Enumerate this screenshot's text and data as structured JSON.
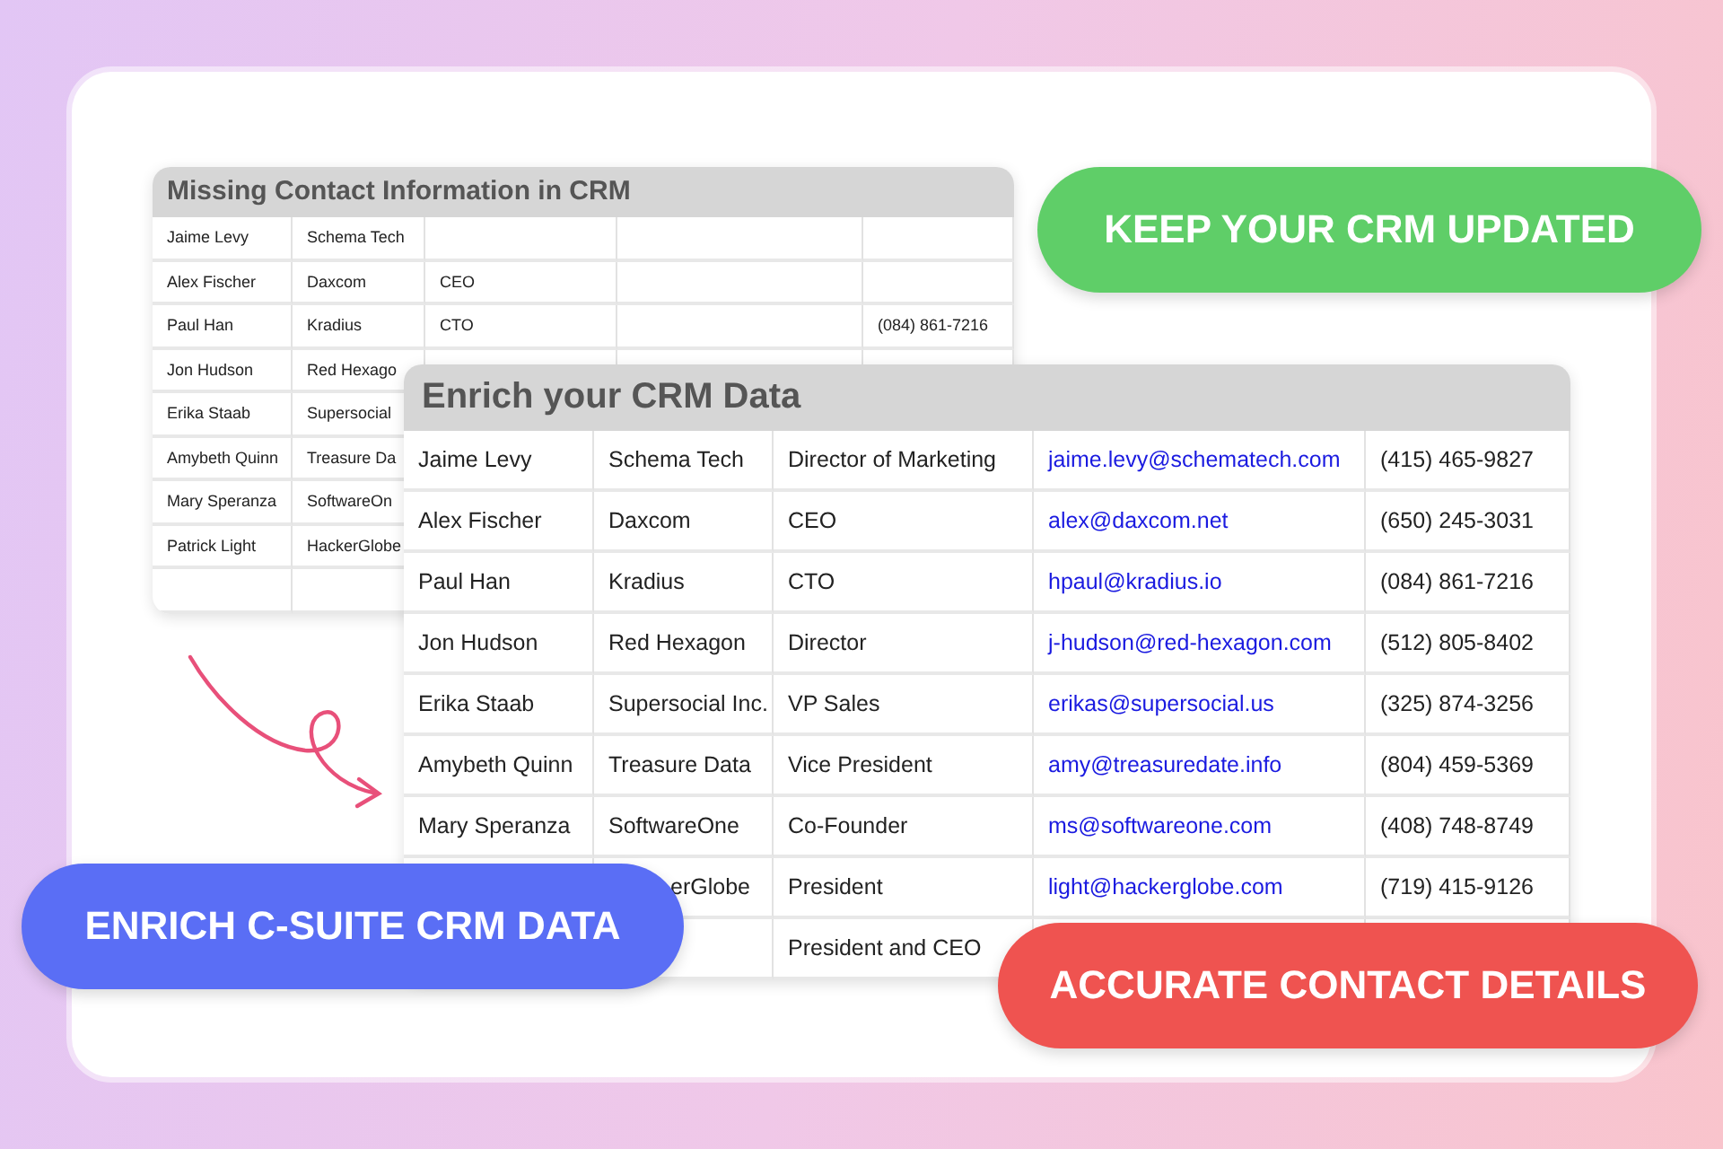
{
  "missing_table": {
    "title": "Missing Contact Information in CRM",
    "rows": [
      [
        "Jaime Levy",
        "Schema Tech",
        null,
        null,
        null
      ],
      [
        "Alex Fischer",
        "Daxcom",
        "CEO",
        null,
        null
      ],
      [
        "Paul Han",
        "Kradius",
        "CTO",
        null,
        "(084) 861-7216"
      ],
      [
        "Jon Hudson",
        "Red Hexago",
        null,
        null,
        null
      ],
      [
        "Erika Staab",
        "Supersocial",
        null,
        null,
        null
      ],
      [
        "Amybeth Quinn",
        "Treasure Da",
        null,
        null,
        null
      ],
      [
        "Mary Speranza",
        "SoftwareOn",
        null,
        null,
        null
      ],
      [
        "Patrick Light",
        "HackerGlobe",
        null,
        null,
        null
      ],
      [
        null,
        null,
        null,
        null,
        null
      ]
    ]
  },
  "enriched_table": {
    "title": "Enrich your CRM Data",
    "rows": [
      [
        "Jaime Levy",
        "Schema Tech",
        "Director of Marketing",
        "jaime.levy@schematech.com",
        "(415) 465-9827"
      ],
      [
        "Alex Fischer",
        "Daxcom",
        "CEO",
        "alex@daxcom.net",
        "(650) 245-3031"
      ],
      [
        "Paul Han",
        "Kradius",
        "CTO",
        "hpaul@kradius.io",
        "(084) 861-7216"
      ],
      [
        "Jon Hudson",
        "Red Hexagon",
        "Director",
        "j-hudson@red-hexagon.com",
        "(512) 805-8402"
      ],
      [
        "Erika Staab",
        "Supersocial Inc.",
        "VP Sales",
        "erikas@supersocial.us",
        "(325) 874-3256"
      ],
      [
        "Amybeth Quinn",
        "Treasure Data",
        "Vice President",
        "amy@treasuredate.info",
        "(804) 459-5369"
      ],
      [
        "Mary Speranza",
        "SoftwareOne",
        "Co-Founder",
        "ms@softwareone.com",
        "(408) 748-8749"
      ],
      [
        null,
        "erGlobe",
        "President",
        "light@hackerglobe.com",
        "(719) 415-9126"
      ],
      [
        null,
        null,
        "President and CEO",
        null,
        null
      ]
    ]
  },
  "banners": [
    {
      "text": "KEEP YOUR CRM UPDATED",
      "color": "#5fce68"
    },
    {
      "text": "ENRICH C-SUITE CRM DATA",
      "color": "#5a6ef5"
    },
    {
      "text": "ACCURATE CONTACT DETAILS",
      "color": "#ef5350"
    }
  ]
}
